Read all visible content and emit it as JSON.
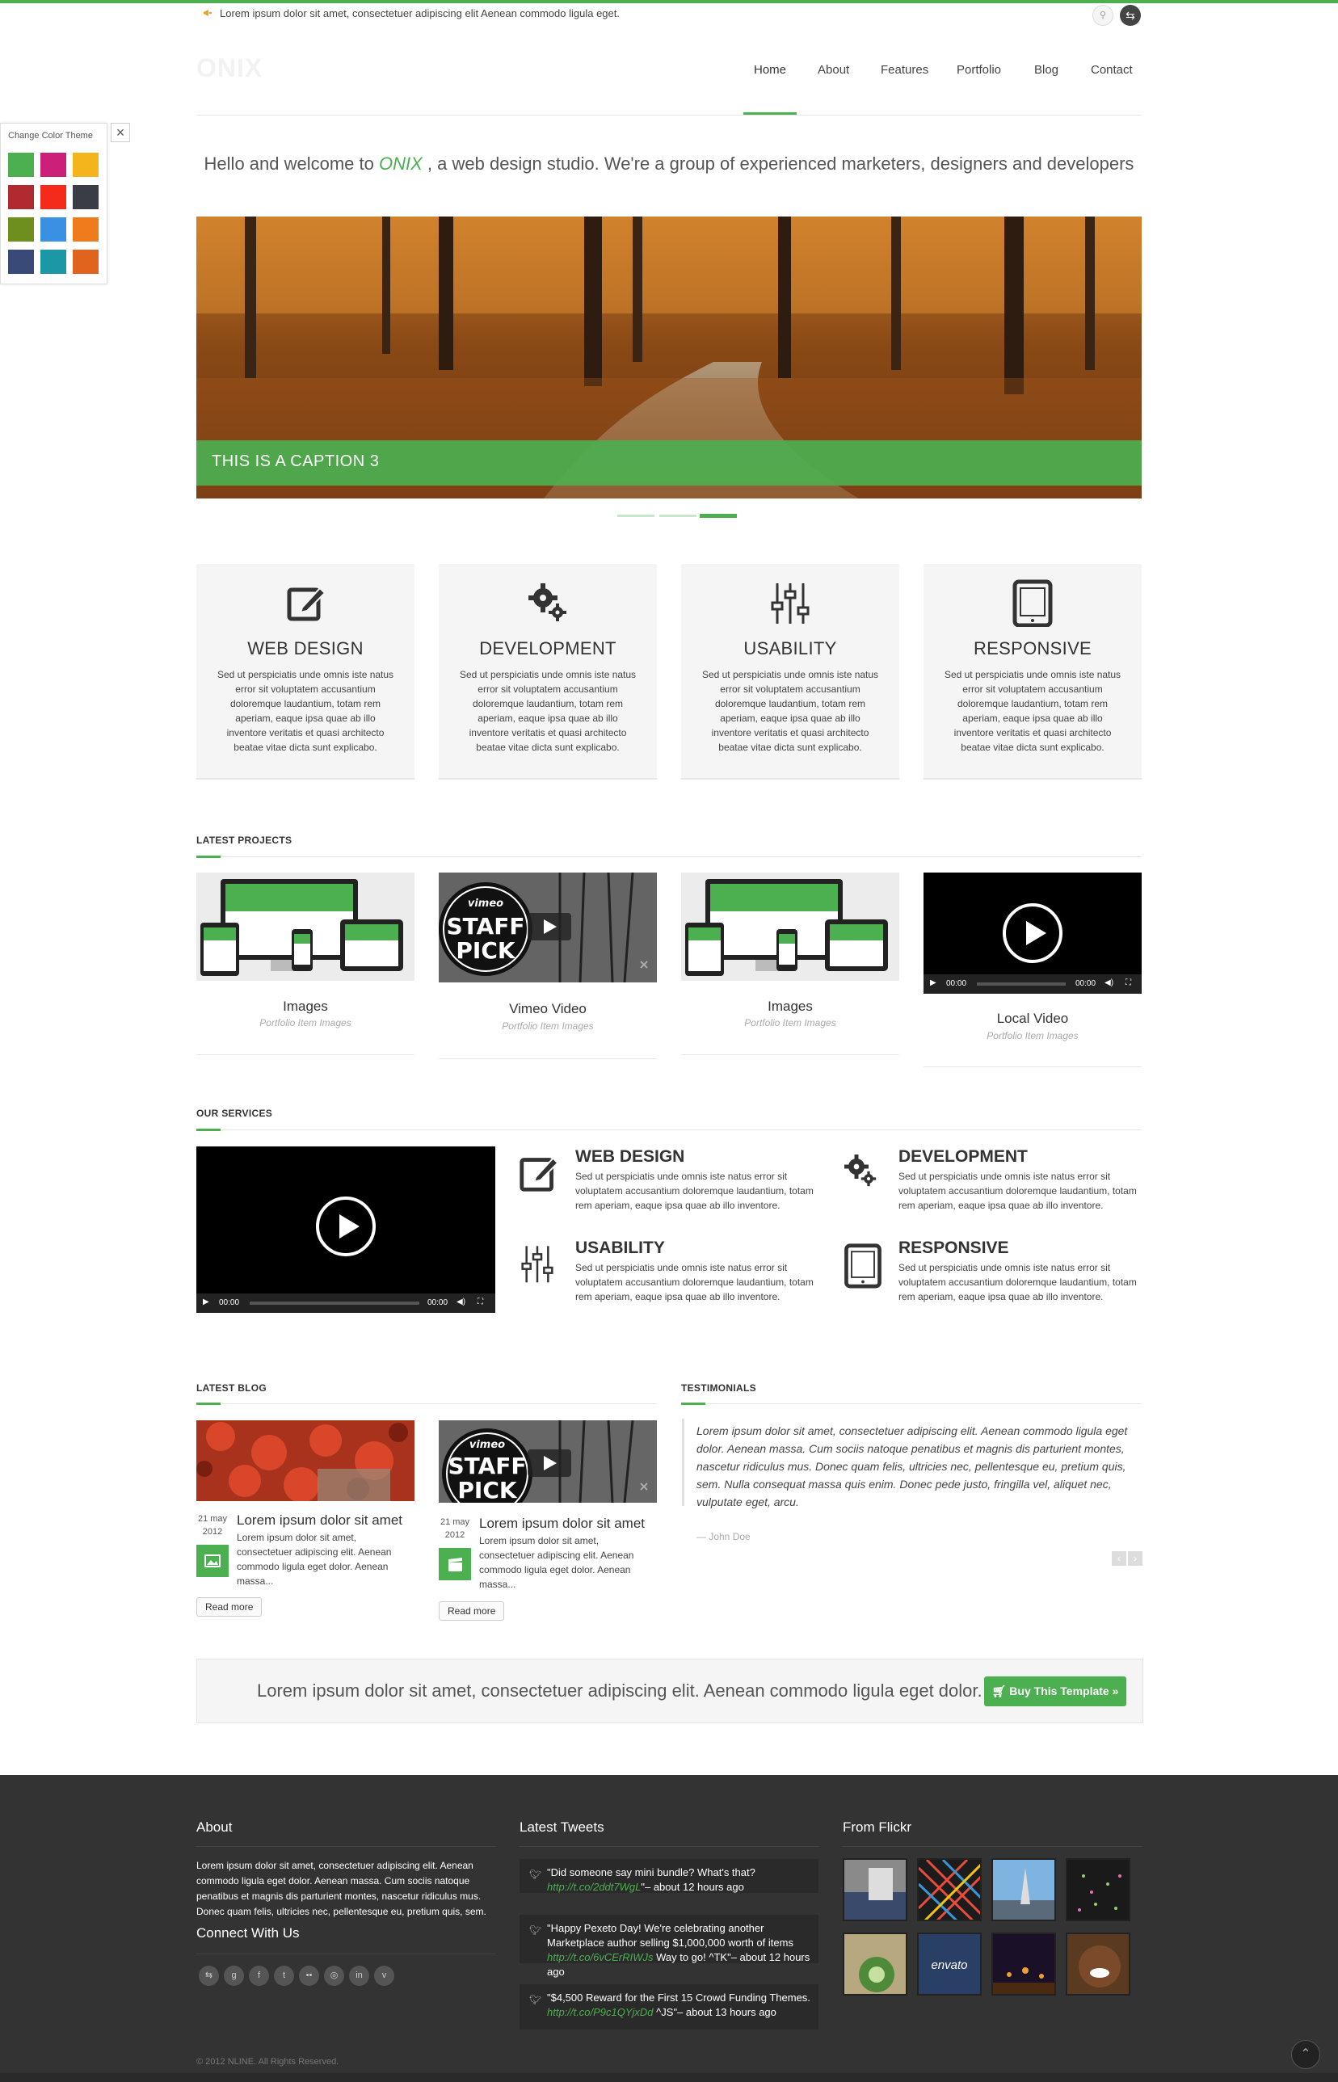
{
  "topbar": {
    "text": "Lorem ipsum dolor sit amet, consectetuer adipiscing elit Aenean commodo ligula eget."
  },
  "logo": {
    "text": "ONIX"
  },
  "nav": {
    "items": [
      "Home",
      "About",
      "Features",
      "Portfolio",
      "Blog",
      "Contact"
    ],
    "active": "Home"
  },
  "welcome": {
    "before": "Hello and welcome to ",
    "brand": "ONIX",
    "after": " , a web design studio. We're a group of experienced marketers, designers and developers"
  },
  "slider": {
    "caption": "THIS IS A CAPTION 3",
    "slide_count": 3,
    "active_slide": 3
  },
  "theme": {
    "title": "Change Color Theme",
    "close": "×",
    "swatches": [
      "#4caf50",
      "#cc1f7a",
      "#f4b51c",
      "#b02a30",
      "#f52a1a",
      "#3a3d45",
      "#6e8f1e",
      "#3a90e2",
      "#f07b1a",
      "#394a78",
      "#1c97a6",
      "#e0641d"
    ]
  },
  "features": [
    {
      "title": "WEB DESIGN",
      "text": "Sed ut perspiciatis unde omnis iste natus error sit voluptatem accusantium doloremque laudantium, totam rem aperiam, eaque ipsa quae ab illo inventore veritatis et quasi architecto beatae vitae dicta sunt explicabo.",
      "icon": "edit-icon"
    },
    {
      "title": "DEVELOPMENT",
      "text": "Sed ut perspiciatis unde omnis iste natus error sit voluptatem accusantium doloremque laudantium, totam rem aperiam, eaque ipsa quae ab illo inventore veritatis et quasi architecto beatae vitae dicta sunt explicabo.",
      "icon": "gears-icon"
    },
    {
      "title": "USABILITY",
      "text": "Sed ut perspiciatis unde omnis iste natus error sit voluptatem accusantium doloremque laudantium, totam rem aperiam, eaque ipsa quae ab illo inventore veritatis et quasi architecto beatae vitae dicta sunt explicabo.",
      "icon": "sliders-icon"
    },
    {
      "title": "RESPONSIVE",
      "text": "Sed ut perspiciatis unde omnis iste natus error sit voluptatem accusantium doloremque laudantium, totam rem aperiam, eaque ipsa quae ab illo inventore veritatis et quasi architecto beatae vitae dicta sunt explicabo.",
      "icon": "tablet-icon"
    }
  ],
  "projects": {
    "title": "LATEST PROJECTS",
    "items": [
      {
        "title": "Images",
        "subtitle": "Portfolio Item Images",
        "type": "image"
      },
      {
        "title": "Vimeo Video",
        "subtitle": "Portfolio Item Images",
        "type": "vimeo",
        "badge_top": "vimeo",
        "badge_main": "STAFF",
        "badge_bottom": "PICK"
      },
      {
        "title": "Images",
        "subtitle": "Portfolio Item Images",
        "type": "image"
      },
      {
        "title": "Local Video",
        "subtitle": "Portfolio Item Images",
        "type": "video",
        "time_current": "00:00",
        "time_total": "00:00"
      }
    ]
  },
  "services": {
    "title": "OUR SERVICES",
    "video": {
      "time_current": "00:00",
      "time_total": "00:00"
    },
    "items": [
      {
        "title": "WEB DESIGN",
        "text": "Sed ut perspiciatis unde omnis iste natus error sit voluptatem accusantium doloremque laudantium, totam rem aperiam, eaque ipsa quae ab illo inventore."
      },
      {
        "title": "DEVELOPMENT",
        "text": "Sed ut perspiciatis unde omnis iste natus error sit voluptatem accusantium doloremque laudantium, totam rem aperiam, eaque ipsa quae ab illo inventore."
      },
      {
        "title": "USABILITY",
        "text": "Sed ut perspiciatis unde omnis iste natus error sit voluptatem accusantium doloremque laudantium, totam rem aperiam, eaque ipsa quae ab illo inventore."
      },
      {
        "title": "RESPONSIVE",
        "text": "Sed ut perspiciatis unde omnis iste natus error sit voluptatem accusantium doloremque laudantium, totam rem aperiam, eaque ipsa quae ab illo inventore."
      }
    ]
  },
  "blog": {
    "title": "LATEST BLOG",
    "posts": [
      {
        "day": "21 may",
        "year": "2012",
        "title": "Lorem ipsum dolor sit amet",
        "text": "Lorem ipsum dolor sit amet, consectetuer adipiscing elit. Aenean commodo ligula eget dolor. Aenean massa...",
        "button": "Read more",
        "icon": "image-icon"
      },
      {
        "day": "21 may",
        "year": "2012",
        "title": "Lorem ipsum dolor sit amet",
        "text": "Lorem ipsum dolor sit amet, consectetuer adipiscing elit. Aenean commodo ligula eget dolor. Aenean massa...",
        "button": "Read more",
        "icon": "clapper-icon",
        "badge_top": "vimeo",
        "badge_main": "STAFF",
        "badge_bottom": "PICK"
      }
    ]
  },
  "testimonials": {
    "title": "TESTIMONIALS",
    "quote": "Lorem ipsum dolor sit amet, consectetuer adipiscing elit. Aenean commodo ligula eget dolor. Aenean massa. Cum sociis natoque penatibus et magnis dis parturient montes, nascetur ridiculus mus. Donec quam felis, ultricies nec, pellentesque eu, pretium quis, sem. Nulla consequat massa quis enim. Donec pede justo, fringilla vel, aliquet nec, vulputate eget, arcu.",
    "author": "— John Doe",
    "prev": "‹",
    "next": "›"
  },
  "cta": {
    "text": "Lorem ipsum dolor sit amet, consectetuer adipiscing elit. Aenean commodo ligula eget dolor.",
    "button": "Buy This Template »"
  },
  "footer": {
    "about_title": "About",
    "about_text": "Lorem ipsum dolor sit amet, consectetuer adipiscing elit. Aenean commodo ligula eget dolor. Aenean massa. Cum sociis natoque penatibus et magnis dis parturient montes, nascetur ridiculus mus. Donec quam felis, ultricies nec, pellentesque eu, pretium quis, sem.",
    "connect_title": "Connect With Us",
    "social": [
      "share-icon",
      "google-icon",
      "facebook-icon",
      "twitter-icon",
      "flickr-icon",
      "dribbble-icon",
      "linkedin-icon",
      "vimeo-icon"
    ],
    "social_glyphs": [
      "⇆",
      "g",
      "f",
      "t",
      "••",
      "◎",
      "in",
      "v"
    ],
    "tweets_title": "Latest Tweets",
    "tweets": [
      {
        "text": "\"Did someone say mini bundle? What's that?",
        "link": "http://t.co/2ddt7WgL",
        "tail": "\"– about 12 hours ago"
      },
      {
        "text": "\"Happy Pexeto Day! We're celebrating another Marketplace author selling $1,000,000 worth of items",
        "link": "http://t.co/6vCErRIWJs",
        "tail": " Way to go! ^TK\"– about 12 hours ago"
      },
      {
        "text": "\"$4,500 Reward for the First 15 Crowd Funding Themes.",
        "link": "http://t.co/P9c1QYjxDd",
        "tail": " ^JS\"– about 13 hours ago"
      }
    ],
    "flickr_title": "From Flickr",
    "flickr_label": "envato",
    "copyright": "© 2012 NLINE. All Rights Reserved.",
    "back_to_top": "⌃"
  },
  "colors": {
    "accent": "#4caf50",
    "footer_bg": "#333333"
  }
}
